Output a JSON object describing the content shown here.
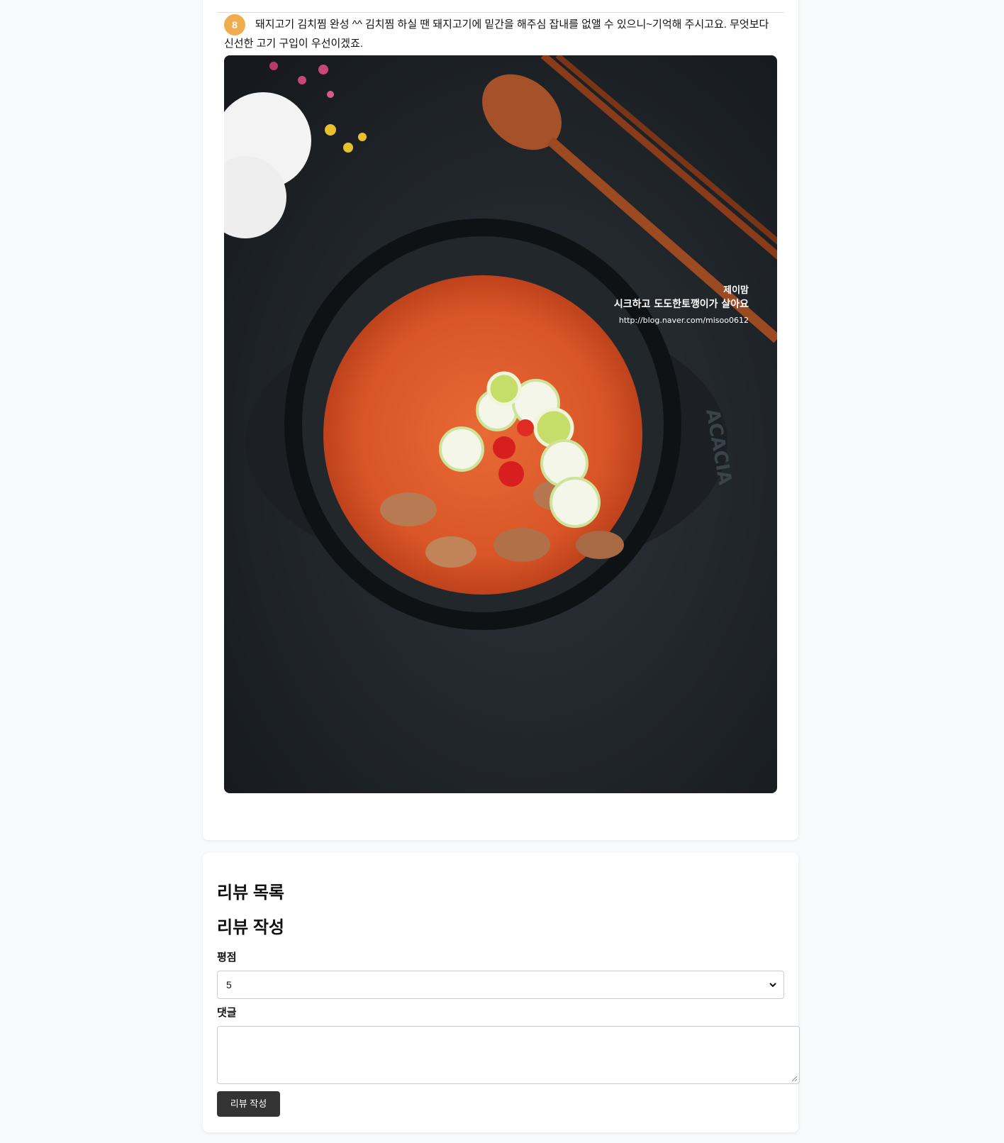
{
  "step": {
    "number": "8",
    "text": "돼지고기 김치찜 완성 ^^ 김치찜 하실 땐 돼지고기에 밑간을 해주심 잡내를 없앨 수 있으니~기억해 주시고요. 무엇보다 신선한 고기 구입이 우선이겠죠."
  },
  "photo": {
    "watermark_line1": "제이맘",
    "watermark_line2": "시크하고 도도한토깽이가 살아요",
    "watermark_line3": "http://blog.naver.com/misoo0612",
    "pot_brand": "ACACIA"
  },
  "reviews": {
    "list_heading": "리뷰 목록",
    "write_heading": "리뷰 작성",
    "rating_label": "평점",
    "rating_value": "5",
    "comment_label": "댓글",
    "comment_value": "",
    "submit_label": "리뷰 작성"
  },
  "colors": {
    "step_badge": "#f0ad4e",
    "button_bg": "#333333",
    "page_bg": "#f8f9fa"
  }
}
